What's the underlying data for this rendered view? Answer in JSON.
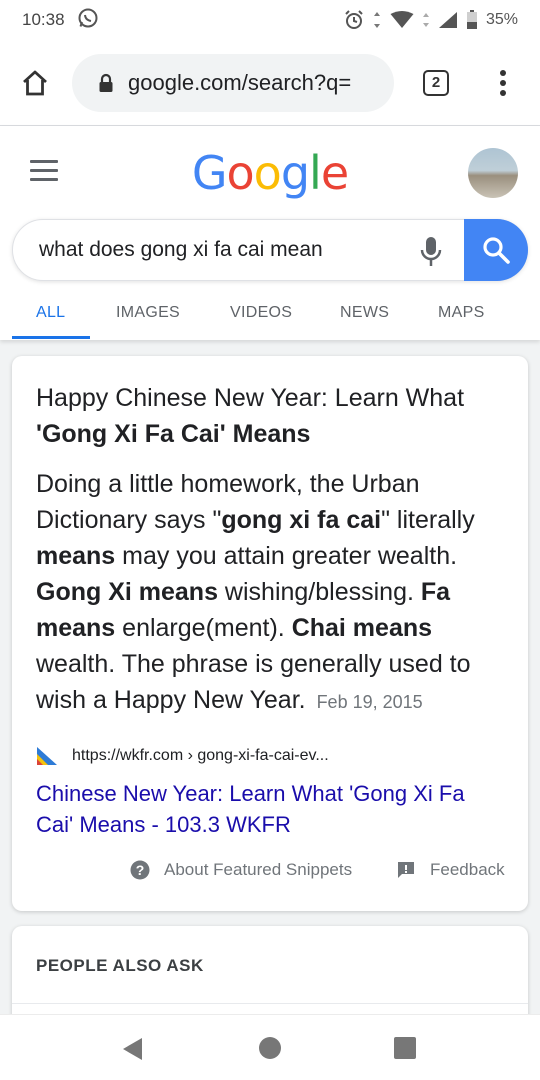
{
  "status_bar": {
    "time": "10:38",
    "battery": "35%"
  },
  "browser": {
    "url": "google.com/search?q=",
    "tab_count": "2"
  },
  "google": {
    "logo_letters": [
      "G",
      "o",
      "o",
      "g",
      "l",
      "e"
    ],
    "logo_colors": [
      "#4285F4",
      "#EA4335",
      "#FBBC05",
      "#4285F4",
      "#34A853",
      "#EA4335"
    ],
    "search_query": "what does gong xi fa cai mean",
    "tabs": [
      "ALL",
      "IMAGES",
      "VIDEOS",
      "NEWS",
      "MAPS"
    ],
    "active_tab": "ALL"
  },
  "snippet": {
    "title_part1": "Happy Chinese New Year: Learn What ",
    "title_part2": "'Gong Xi Fa Cai' Means",
    "body": [
      {
        "text": "Doing a little homework, the Urban Dictionary says \"",
        "bold": false
      },
      {
        "text": "gong xi fa cai",
        "bold": true
      },
      {
        "text": "\" literally ",
        "bold": false
      },
      {
        "text": "means",
        "bold": true
      },
      {
        "text": " may you attain greater wealth. ",
        "bold": false
      },
      {
        "text": "Gong Xi means",
        "bold": true
      },
      {
        "text": " wishing/blessing. ",
        "bold": false
      },
      {
        "text": "Fa means",
        "bold": true
      },
      {
        "text": " enlarge(ment). ",
        "bold": false
      },
      {
        "text": "Chai means",
        "bold": true
      },
      {
        "text": " wealth. The phrase is generally used to wish a Happy New Year.",
        "bold": false
      }
    ],
    "date": "Feb 19, 2015",
    "source_url": "https://wkfr.com › gong-xi-fa-cai-ev...",
    "link_text": "Chinese New Year: Learn What 'Gong Xi Fa Cai' Means - 103.3 WKFR",
    "about_label": "About Featured Snippets",
    "feedback_label": "Feedback"
  },
  "people_also_ask": {
    "title": "PEOPLE ALSO ASK"
  },
  "colors": {
    "accent": "#1a73e8",
    "link": "#1a0dab",
    "search_button": "#4285f4"
  },
  "icons": [
    "whatsapp-icon",
    "alarm-icon",
    "data-arrows-icon",
    "wifi-icon",
    "signal-icon",
    "battery-icon",
    "home-icon",
    "lock-icon",
    "tabs-icon",
    "more-vert-icon",
    "menu-icon",
    "mic-icon",
    "search-icon",
    "favicon-icon",
    "help-icon",
    "feedback-icon",
    "back-icon",
    "home-circle-icon",
    "recents-icon"
  ]
}
